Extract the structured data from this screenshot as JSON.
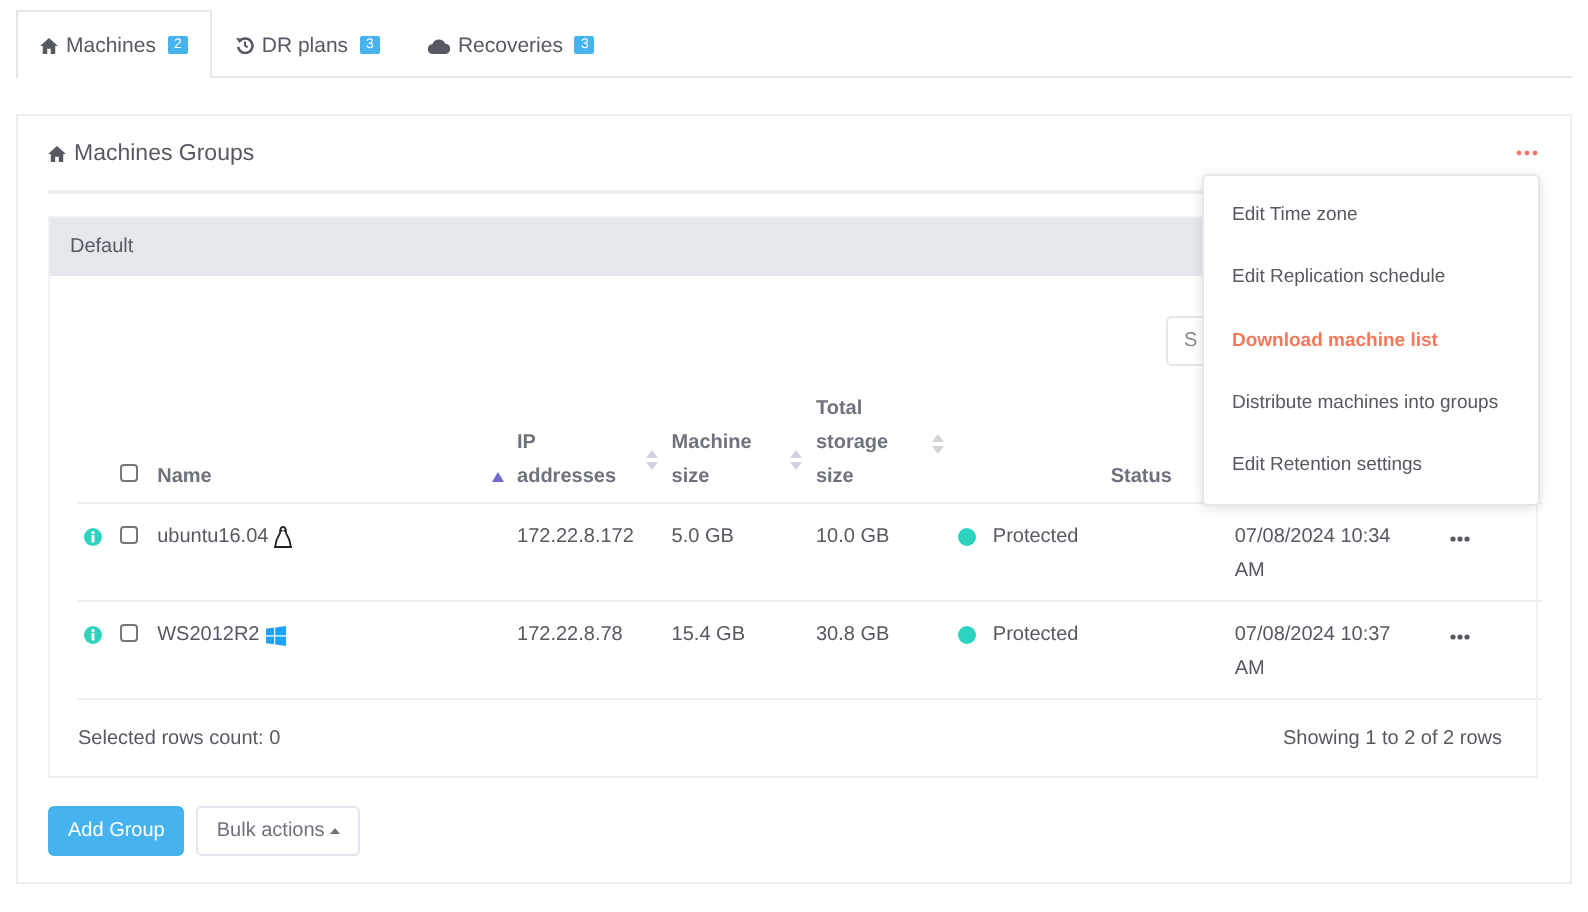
{
  "tabs": [
    {
      "label": "Machines",
      "badge": "2",
      "selected": true
    },
    {
      "label": "DR plans",
      "badge": "3",
      "selected": false
    },
    {
      "label": "Recoveries",
      "badge": "3",
      "selected": false
    }
  ],
  "panel": {
    "title": "Machines Groups",
    "menu": [
      {
        "label": "Edit Time zone",
        "highlighted": false
      },
      {
        "label": "Edit Replication schedule",
        "highlighted": false
      },
      {
        "label": "Download machine list",
        "highlighted": true
      },
      {
        "label": "Distribute machines into groups",
        "highlighted": false
      },
      {
        "label": "Edit Retention settings",
        "highlighted": false
      }
    ]
  },
  "group": {
    "title": "Default",
    "search": {
      "placeholder": "S"
    },
    "table": {
      "all_checked": false,
      "columns": [
        "Name",
        "IP addresses",
        "Machine size",
        "Total storage size",
        "Status"
      ],
      "rows": [
        {
          "name": "ubuntu16.04",
          "checked": false,
          "ip": "172.22.8.172",
          "machine_size": "5.0 GB",
          "storage": "10.0 GB",
          "status": "Protected",
          "color": "#2ed3c0",
          "date": "07/08/2024 10:34 AM"
        },
        {
          "name": "WS2012R2",
          "checked": false,
          "ip": "172.22.8.78",
          "machine_size": "15.4 GB",
          "storage": "30.8 GB",
          "status": "Protected",
          "color": "#2ed3c0",
          "date": "07/08/2024 10:37 AM"
        }
      ]
    },
    "selected_count": "Selected rows count: 0",
    "showing": "Showing 1 to 2 of 2 rows"
  },
  "buttons": [
    {
      "label": "Add Group",
      "kind": "primary"
    },
    {
      "label": "Bulk actions",
      "kind": "dropdown"
    }
  ]
}
